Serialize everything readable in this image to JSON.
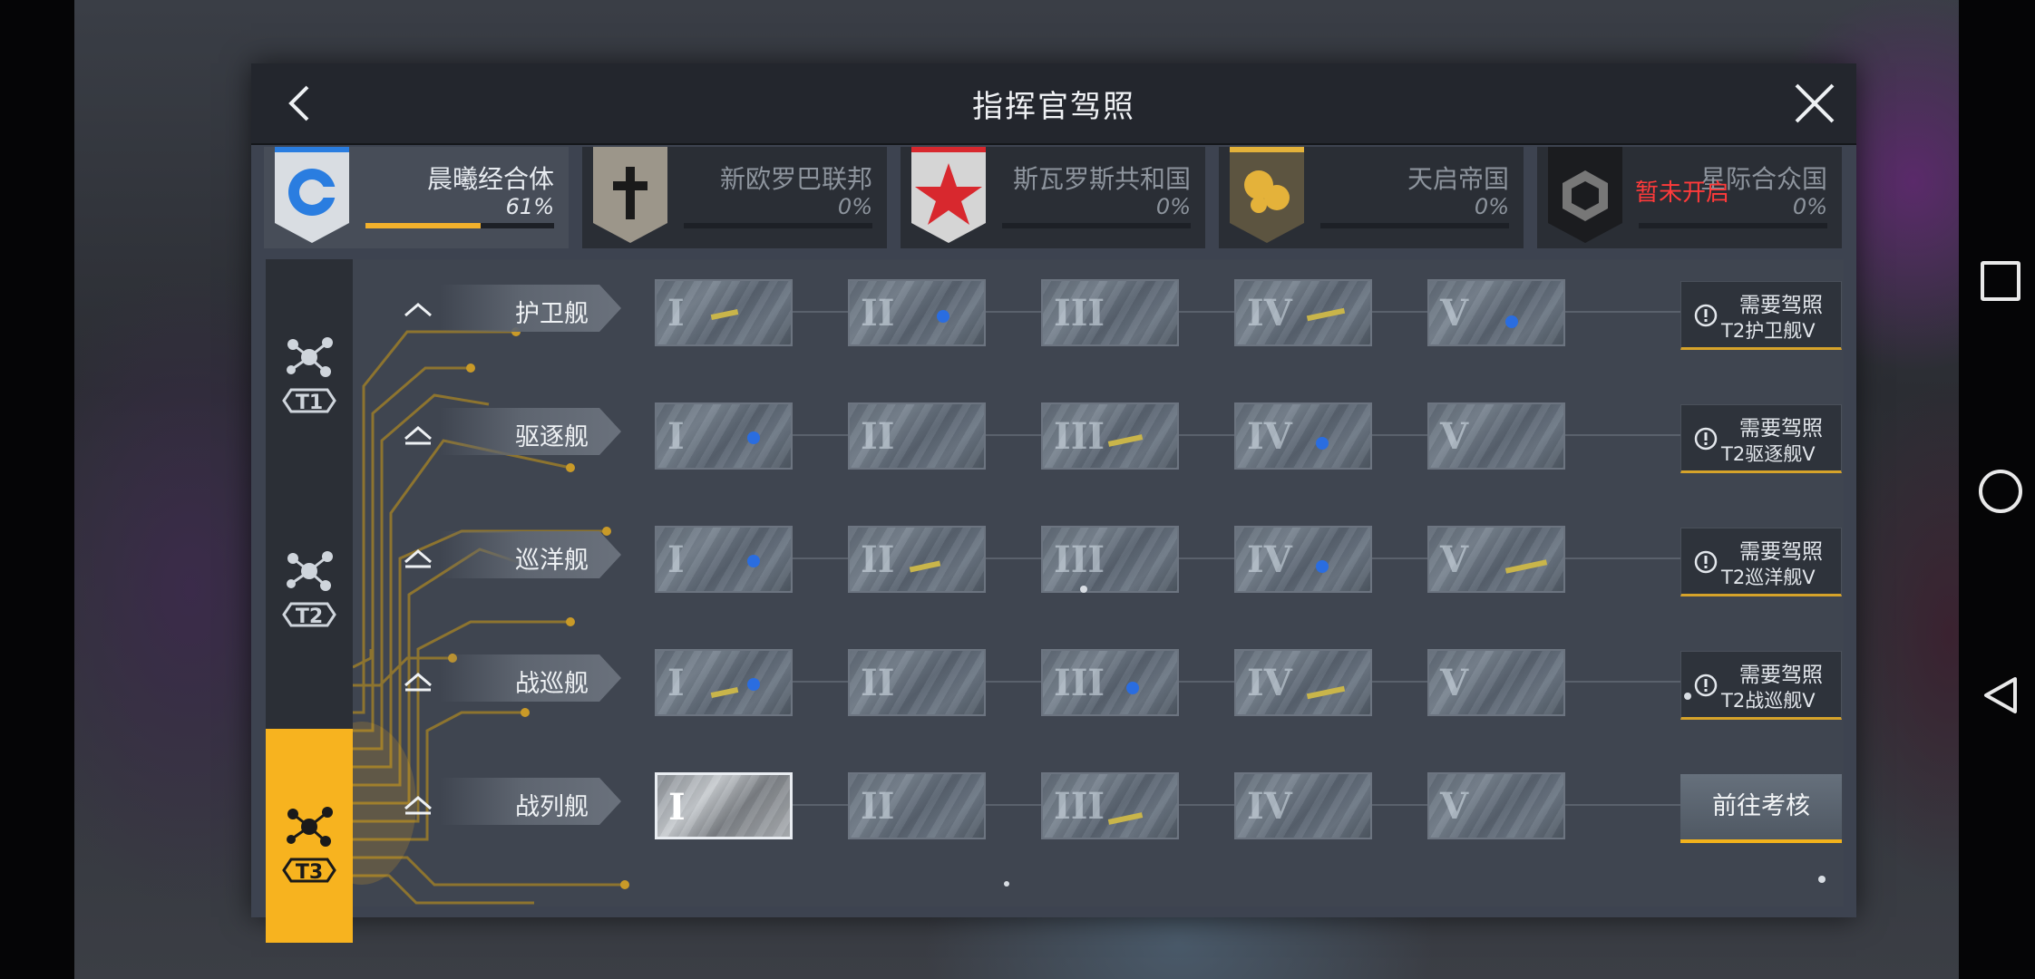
{
  "window": {
    "title": "指挥官驾照"
  },
  "factions": [
    {
      "name": "晨曦经合体",
      "percent": "61%",
      "progress": 0.61,
      "active": true,
      "color": "#2a7de0"
    },
    {
      "name": "新欧罗巴联邦",
      "percent": "0%",
      "progress": 0,
      "active": false,
      "color": "#1a1a1a"
    },
    {
      "name": "斯瓦罗斯共和国",
      "percent": "0%",
      "progress": 0,
      "active": false,
      "color": "#d8282e"
    },
    {
      "name": "天启帝国",
      "percent": "0%",
      "progress": 0,
      "active": false,
      "color": "#e4b23a"
    },
    {
      "name": "星际合众国",
      "percent": "0%",
      "progress": 0,
      "active": false,
      "locked_label": "暂未开启",
      "color": "#2b2b2b"
    }
  ],
  "tiers": [
    {
      "label": "T1",
      "active": false
    },
    {
      "label": "T2",
      "active": false
    },
    {
      "label": "T3",
      "active": true
    }
  ],
  "numerals": [
    "I",
    "II",
    "III",
    "IV",
    "V"
  ],
  "rows": [
    {
      "ship": "护卫舰",
      "req_line1": "需要驾照",
      "req_line2": "T2护卫舰V"
    },
    {
      "ship": "驱逐舰",
      "req_line1": "需要驾照",
      "req_line2": "T2驱逐舰V"
    },
    {
      "ship": "巡洋舰",
      "req_line1": "需要驾照",
      "req_line2": "T2巡洋舰V"
    },
    {
      "ship": "战巡舰",
      "req_line1": "需要驾照",
      "req_line2": "T2战巡舰V"
    },
    {
      "ship": "战列舰",
      "action": "前往考核"
    }
  ],
  "colors": {
    "accent": "#f7b31f",
    "locked": "#ff3a3a",
    "panel": "#3d4350"
  }
}
